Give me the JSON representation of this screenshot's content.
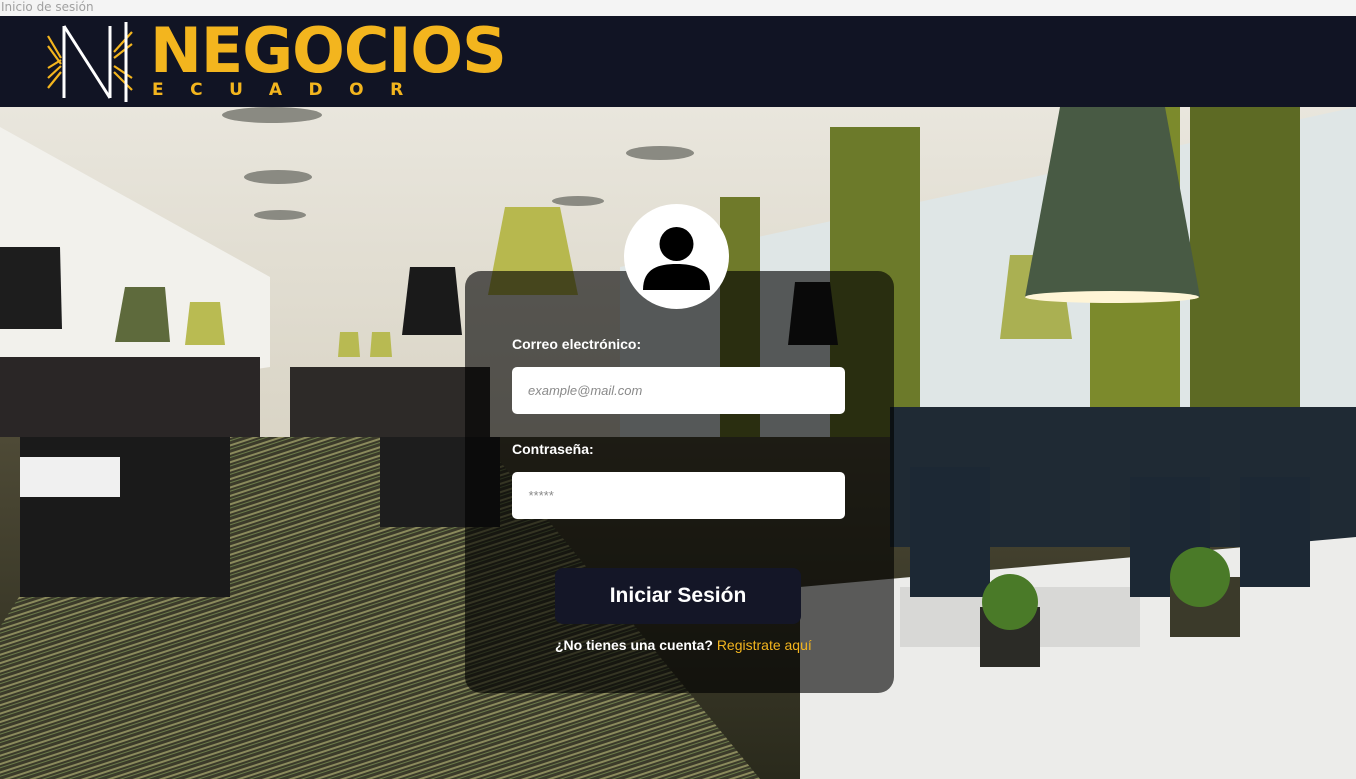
{
  "window": {
    "title": "Inicio de sesión"
  },
  "brand": {
    "name": "NEGOCIOS",
    "subtitle": "ECUADOR",
    "color": "#f3b51e",
    "header_bg": "#111424"
  },
  "login": {
    "email_label": "Correo electrónico:",
    "email_placeholder": "example@mail.com",
    "password_label": "Contraseña:",
    "password_placeholder": "*****",
    "submit_label": "Iniciar Sesión",
    "no_account_text": "¿No tienes una cuenta?",
    "register_link": "Registrate aquí",
    "avatar_icon": "user-icon"
  }
}
